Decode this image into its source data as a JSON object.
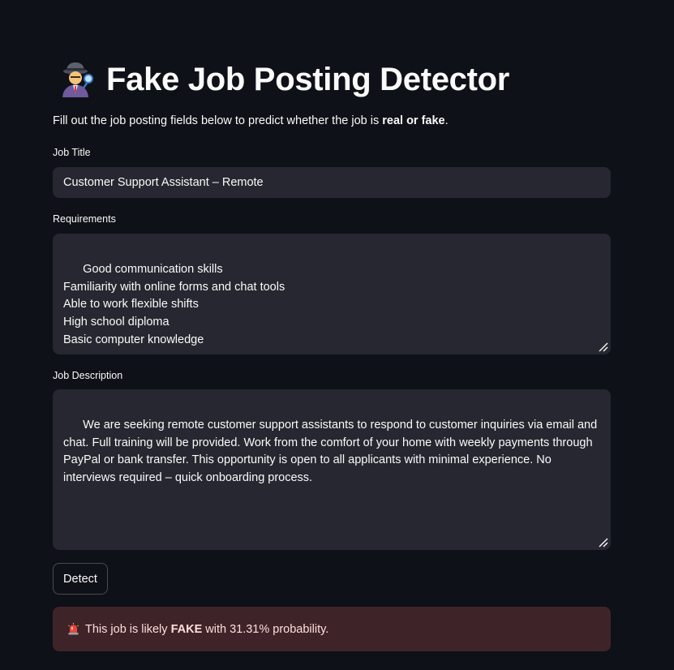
{
  "app": {
    "title": "Fake Job Posting Detector",
    "title_icon": "detective-emoji-icon",
    "intro_prefix": "Fill out the job posting fields below to predict whether the job is ",
    "intro_bold": "real or fake",
    "intro_suffix": "."
  },
  "form": {
    "job_title": {
      "label": "Job Title",
      "value": "Customer Support Assistant – Remote"
    },
    "requirements": {
      "label": "Requirements",
      "value": "Good communication skills\nFamiliarity with online forms and chat tools\nAble to work flexible shifts\nHigh school diploma\nBasic computer knowledge"
    },
    "job_description": {
      "label": "Job Description",
      "value": "We are seeking remote customer support assistants to respond to customer inquiries via email and chat. Full training will be provided. Work from the comfort of your home with weekly payments through PayPal or bank transfer. This opportunity is open to all applicants with minimal experience. No interviews required – quick onboarding process."
    },
    "detect_label": "Detect"
  },
  "result": {
    "icon": "siren-icon",
    "prefix": "This job is likely ",
    "verdict": "FAKE",
    "suffix": " with 31.31% probability."
  },
  "colors": {
    "background": "#0e1117",
    "field_bg": "#262730",
    "alert_bg": "#3e2428",
    "alert_text": "#ffdede"
  }
}
